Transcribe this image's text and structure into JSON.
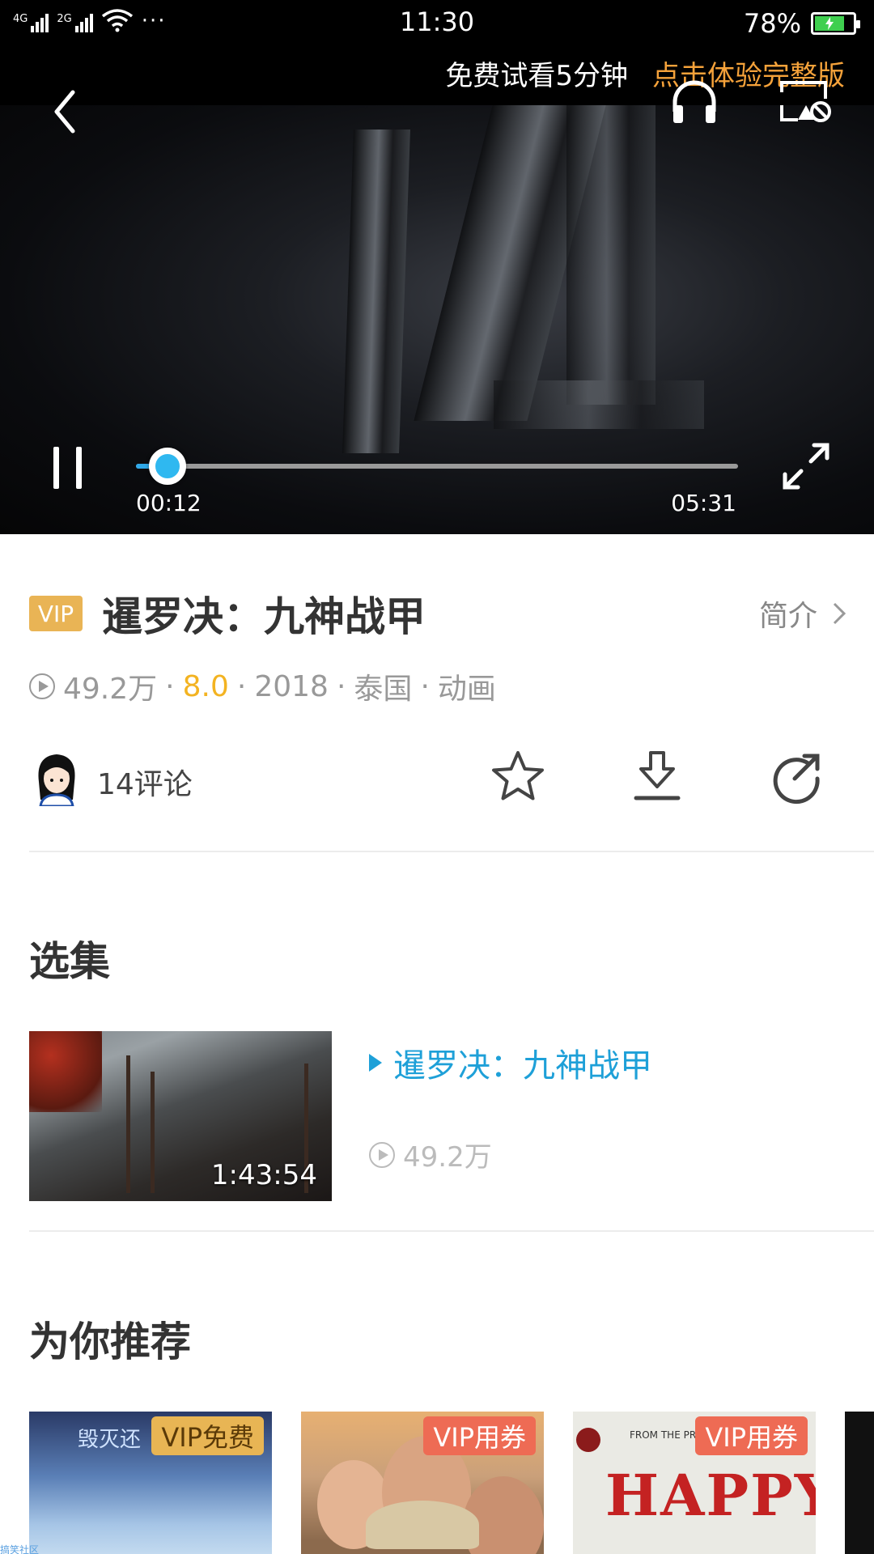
{
  "status_bar": {
    "sim1_label": "4G",
    "sim2_label": "2G",
    "more_dots": "···",
    "time": "11:30",
    "battery_percent": "78%",
    "battery_level": 0.78
  },
  "player": {
    "trial_text": "免费试看5分钟",
    "trial_link": "点击体验完整版",
    "current_time": "00:12",
    "total_time": "05:31",
    "progress": 0.036
  },
  "video": {
    "vip_label": "VIP",
    "title": "暹罗决：九神战甲",
    "intro_label": "简介",
    "views": "49.2万",
    "rating": "8.0",
    "year": "2018",
    "country": "泰国",
    "genre": "动画",
    "separator": "·",
    "comments": "14评论"
  },
  "episodes": {
    "section_title": "选集",
    "items": [
      {
        "title": "暹罗决：九神战甲",
        "duration": "1:43:54",
        "views": "49.2万"
      }
    ]
  },
  "recommendations": {
    "section_title": "为你推荐",
    "items": [
      {
        "badge": "VIP免费",
        "poster_text": "毁灭还"
      },
      {
        "badge": "VIP用券"
      },
      {
        "badge": "VIP用券",
        "poster_text": "HAPPY",
        "poster_tag": "FROM THE PR... GET OUT, THE PUR..."
      }
    ]
  },
  "watermark": "搞笑社区",
  "colors": {
    "accent_blue": "#1ea0d8",
    "vip_gold": "#e9b455",
    "trial_orange": "#f5a23a",
    "rating_yellow": "#f3b321",
    "coupon_red": "#ee6b54"
  }
}
